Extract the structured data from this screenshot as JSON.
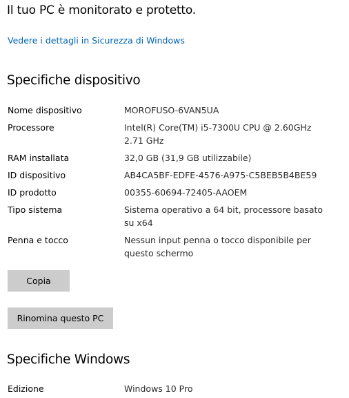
{
  "status": {
    "text": "Il tuo PC è monitorato e protetto.",
    "link": "Vedere i dettagli in Sicurezza di Windows"
  },
  "device_specs": {
    "title": "Specifiche dispositivo",
    "rows": [
      {
        "label": "Nome dispositivo",
        "value": "MOROFUSO-6VAN5UA"
      },
      {
        "label": "Processore",
        "value": "Intel(R) Core(TM) i5-7300U CPU @ 2.60GHz 2.71 GHz"
      },
      {
        "label": "RAM installata",
        "value": "32,0 GB (31,9 GB utilizzabile)"
      },
      {
        "label": "ID dispositivo",
        "value": "AB4CA5BF-EDFE-4576-A975-C5BEB5B4BE59"
      },
      {
        "label": "ID prodotto",
        "value": "00355-60694-72405-AAOEM"
      },
      {
        "label": "Tipo sistema",
        "value": "Sistema operativo a 64 bit, processore basato su x64"
      },
      {
        "label": "Penna e tocco",
        "value": "Nessun input penna o tocco disponibile per questo schermo"
      }
    ],
    "copy_label": "Copia",
    "rename_label": "Rinomina questo PC"
  },
  "windows_specs": {
    "title": "Specifiche Windows",
    "rows": [
      {
        "label": "Edizione",
        "value": "Windows 10 Pro"
      }
    ]
  },
  "colors": {
    "link": "#0063b1",
    "button_bg": "#cccccc"
  }
}
